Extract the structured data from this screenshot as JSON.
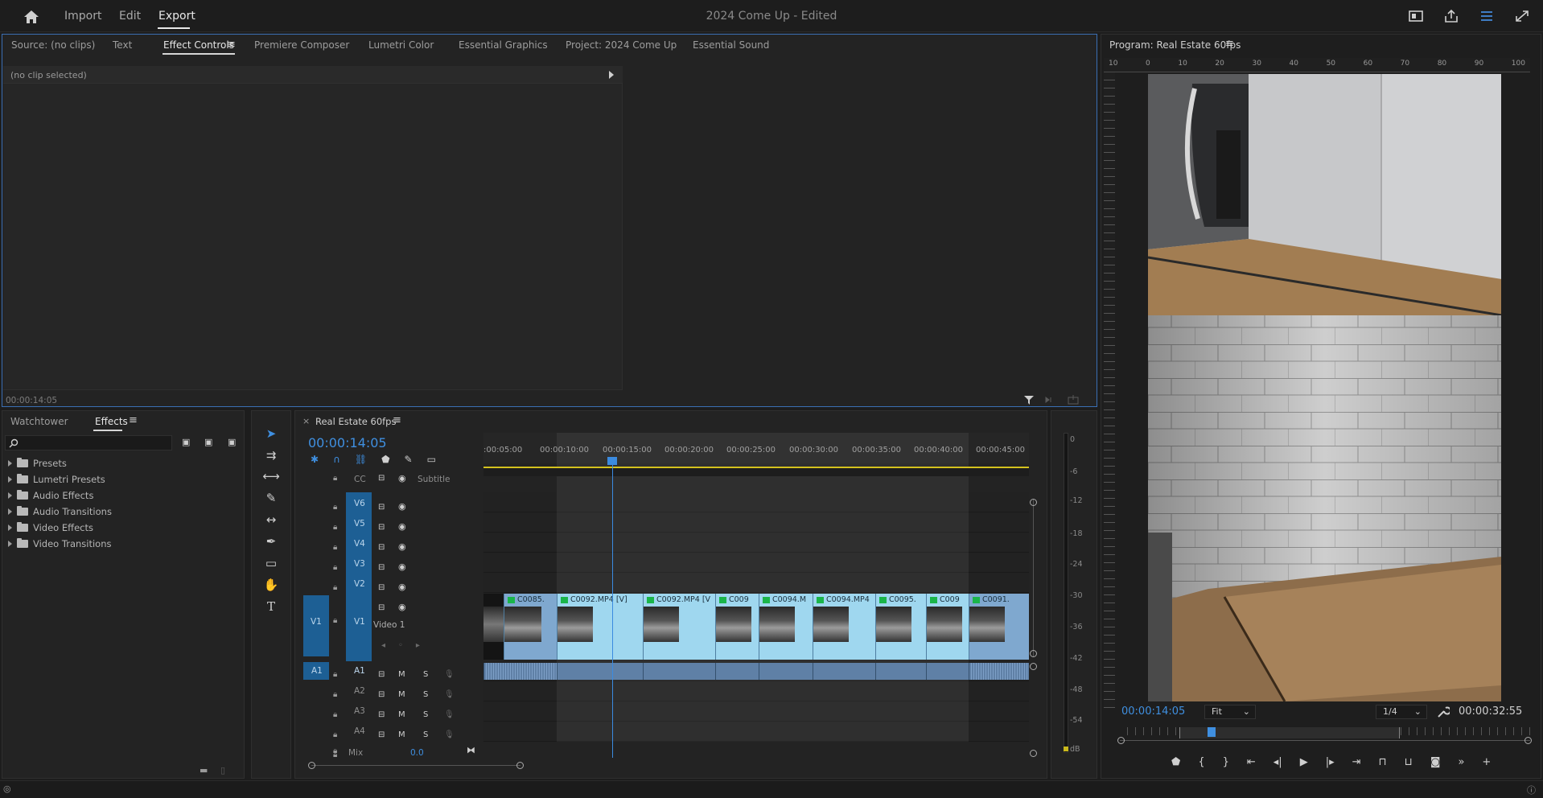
{
  "topbar": {
    "nav": [
      "Import",
      "Edit",
      "Export"
    ],
    "active": "Export",
    "title": "2024 Come Up",
    "status": "Edited",
    "icons": [
      "home-icon",
      "quick-export-icon",
      "share-icon",
      "workspace-icon",
      "fullscreen-icon"
    ]
  },
  "effect_panel": {
    "tabs": [
      "Source: (no clips)",
      "Text",
      "Effect Controls",
      "Premiere Composer",
      "Lumetri Color",
      "Essential Graphics",
      "Project: 2024 Come Up",
      "Essential Sound"
    ],
    "active_tab": "Effect Controls",
    "no_clip": "(no clip selected)",
    "timecode": "00:00:14:05"
  },
  "program": {
    "title": "Program: Real Estate 60fps",
    "ruler_ticks": [
      "10",
      "0",
      "10",
      "20",
      "30",
      "40",
      "50",
      "60",
      "70",
      "80",
      "90",
      "100"
    ],
    "timecode": "00:00:14:05",
    "fit": "Fit",
    "resolution": "1/4",
    "duration": "00:00:32:55"
  },
  "effects_panel": {
    "tabs": [
      "Watchtower",
      "Effects"
    ],
    "active_tab": "Effects",
    "search_placeholder": "",
    "items": [
      "Presets",
      "Lumetri Presets",
      "Audio Effects",
      "Audio Transitions",
      "Video Effects",
      "Video Transitions"
    ]
  },
  "timeline": {
    "title": "Real Estate 60fps",
    "timecode": "00:00:14:05",
    "ruler": [
      ":00:05:00",
      "00:00:10:00",
      "00:00:15:00",
      "00:00:20:00",
      "00:00:25:00",
      "00:00:30:00",
      "00:00:35:00",
      "00:00:40:00",
      "00:00:45:00"
    ],
    "subtitle_label": "Subtitle",
    "video_tracks": [
      "V6",
      "V5",
      "V4",
      "V3",
      "V2",
      "V1"
    ],
    "v1_name": "Video 1",
    "audio_tracks": [
      "A1",
      "A2",
      "A3",
      "A4"
    ],
    "mix_label": "Mix",
    "mix_value": "0.0",
    "source_v": "V1",
    "source_a": "A1",
    "clips": [
      "C0085.",
      "C0092.MP4 [V]",
      "C0092.MP4 [V",
      "C009",
      "C0094.M",
      "C0094.MP4",
      "C0095.",
      "C009",
      "C0091."
    ]
  },
  "meter": {
    "labels": [
      "0",
      "-6",
      "-12",
      "-18",
      "-24",
      "-30",
      "-36",
      "-42",
      "-48",
      "-54",
      "dB"
    ]
  }
}
